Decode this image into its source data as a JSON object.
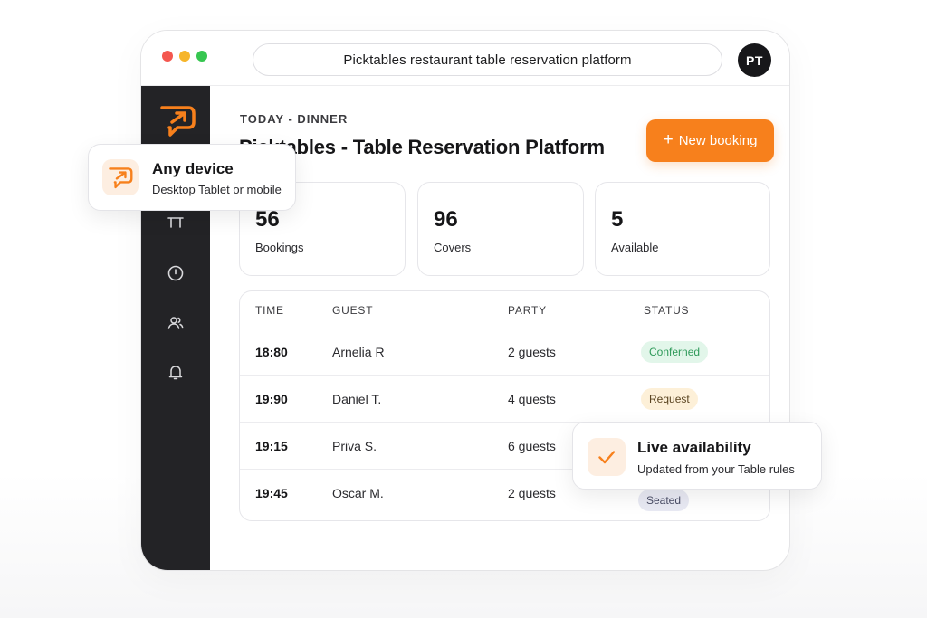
{
  "browser": {
    "url_title": "Picktables restaurant table reservation platform",
    "avatar_initials": "PT"
  },
  "header": {
    "eyebrow": "TODAY - DINNER",
    "title": "Picktables - Table Reservation Platform",
    "new_booking_label": "New booking",
    "new_booking_icon": "plus-icon"
  },
  "stats": [
    {
      "value": "56",
      "label": "Bookings"
    },
    {
      "value": "96",
      "label": "Covers"
    },
    {
      "value": "5",
      "label": "Available"
    }
  ],
  "table": {
    "columns": [
      "TIME",
      "GUEST",
      "PARTY",
      "STATUS"
    ],
    "rows": [
      {
        "time": "18:80",
        "guest": "Arnelia R",
        "party": "2 guests",
        "status": "Conferned"
      },
      {
        "time": "19:90",
        "guest": "Daniel T.",
        "party": "4 quests",
        "status": "Request"
      },
      {
        "time": "19:15",
        "guest": "Priva S.",
        "party": "6 guests",
        "status": ""
      },
      {
        "time": "19:45",
        "guest": "Oscar M.",
        "party": "2 quests",
        "status": "Seated"
      }
    ]
  },
  "sidebar": {
    "icons": [
      "logo-icon",
      "table-icon",
      "clock-icon",
      "users-icon",
      "bell-icon"
    ]
  },
  "cards": {
    "device": {
      "title": "Any device",
      "subtitle": "Desktop Tablet or mobile"
    },
    "live": {
      "title": "Live availability",
      "subtitle": "Updated from your Table rules"
    }
  },
  "colors": {
    "accent": "#f7801c",
    "sidebar": "#232326",
    "status_confirmed_bg": "#e2f6ea",
    "status_confirmed_text": "#2f9a5a",
    "status_request_bg": "#fdf0d8",
    "status_request_text": "#5a4420",
    "status_seated_bg": "#e8e9f3",
    "status_seated_text": "#4a4d66"
  }
}
